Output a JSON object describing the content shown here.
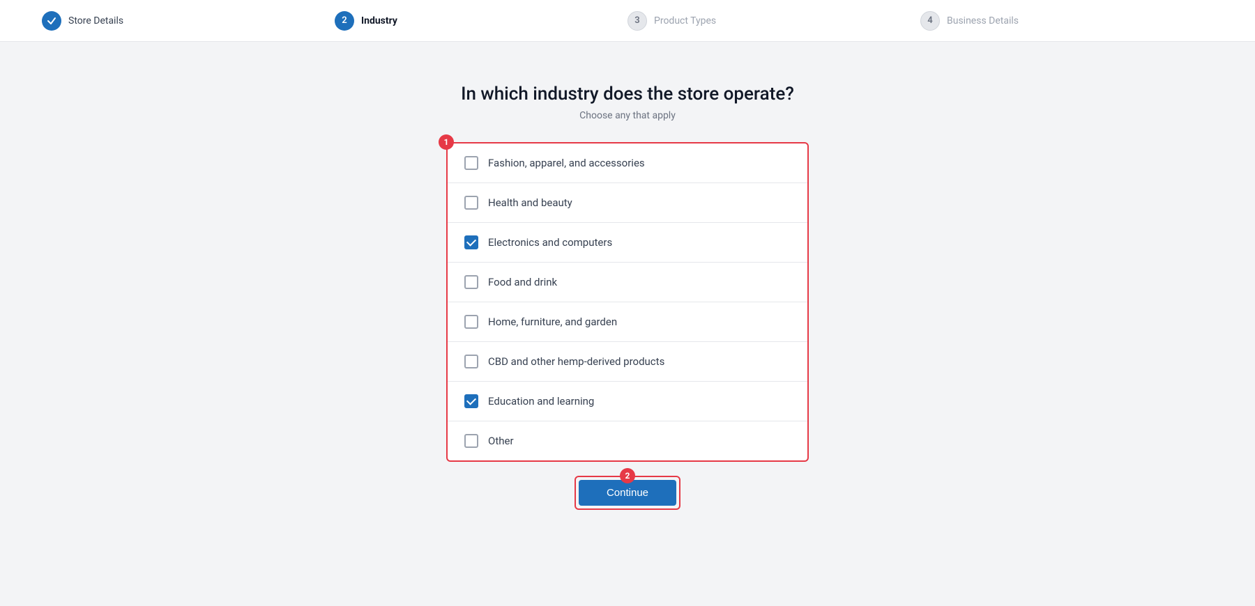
{
  "stepper": {
    "steps": [
      {
        "id": "store-details",
        "number": "✓",
        "label": "Store Details",
        "state": "done"
      },
      {
        "id": "industry",
        "number": "2",
        "label": "Industry",
        "state": "active"
      },
      {
        "id": "product-types",
        "number": "3",
        "label": "Product Types",
        "state": "inactive"
      },
      {
        "id": "business-details",
        "number": "4",
        "label": "Business Details",
        "state": "inactive"
      }
    ]
  },
  "page": {
    "title": "In which industry does the store operate?",
    "subtitle": "Choose any that apply"
  },
  "checklist": {
    "items": [
      {
        "id": "fashion",
        "label": "Fashion, apparel, and accessories",
        "checked": false
      },
      {
        "id": "health",
        "label": "Health and beauty",
        "checked": false
      },
      {
        "id": "electronics",
        "label": "Electronics and computers",
        "checked": true
      },
      {
        "id": "food",
        "label": "Food and drink",
        "checked": false
      },
      {
        "id": "home",
        "label": "Home, furniture, and garden",
        "checked": false
      },
      {
        "id": "cbd",
        "label": "CBD and other hemp-derived products",
        "checked": false
      },
      {
        "id": "education",
        "label": "Education and learning",
        "checked": true
      },
      {
        "id": "other",
        "label": "Other",
        "checked": false
      }
    ]
  },
  "buttons": {
    "continue": "Continue"
  },
  "annotations": {
    "badge1": "1",
    "badge2": "2"
  }
}
